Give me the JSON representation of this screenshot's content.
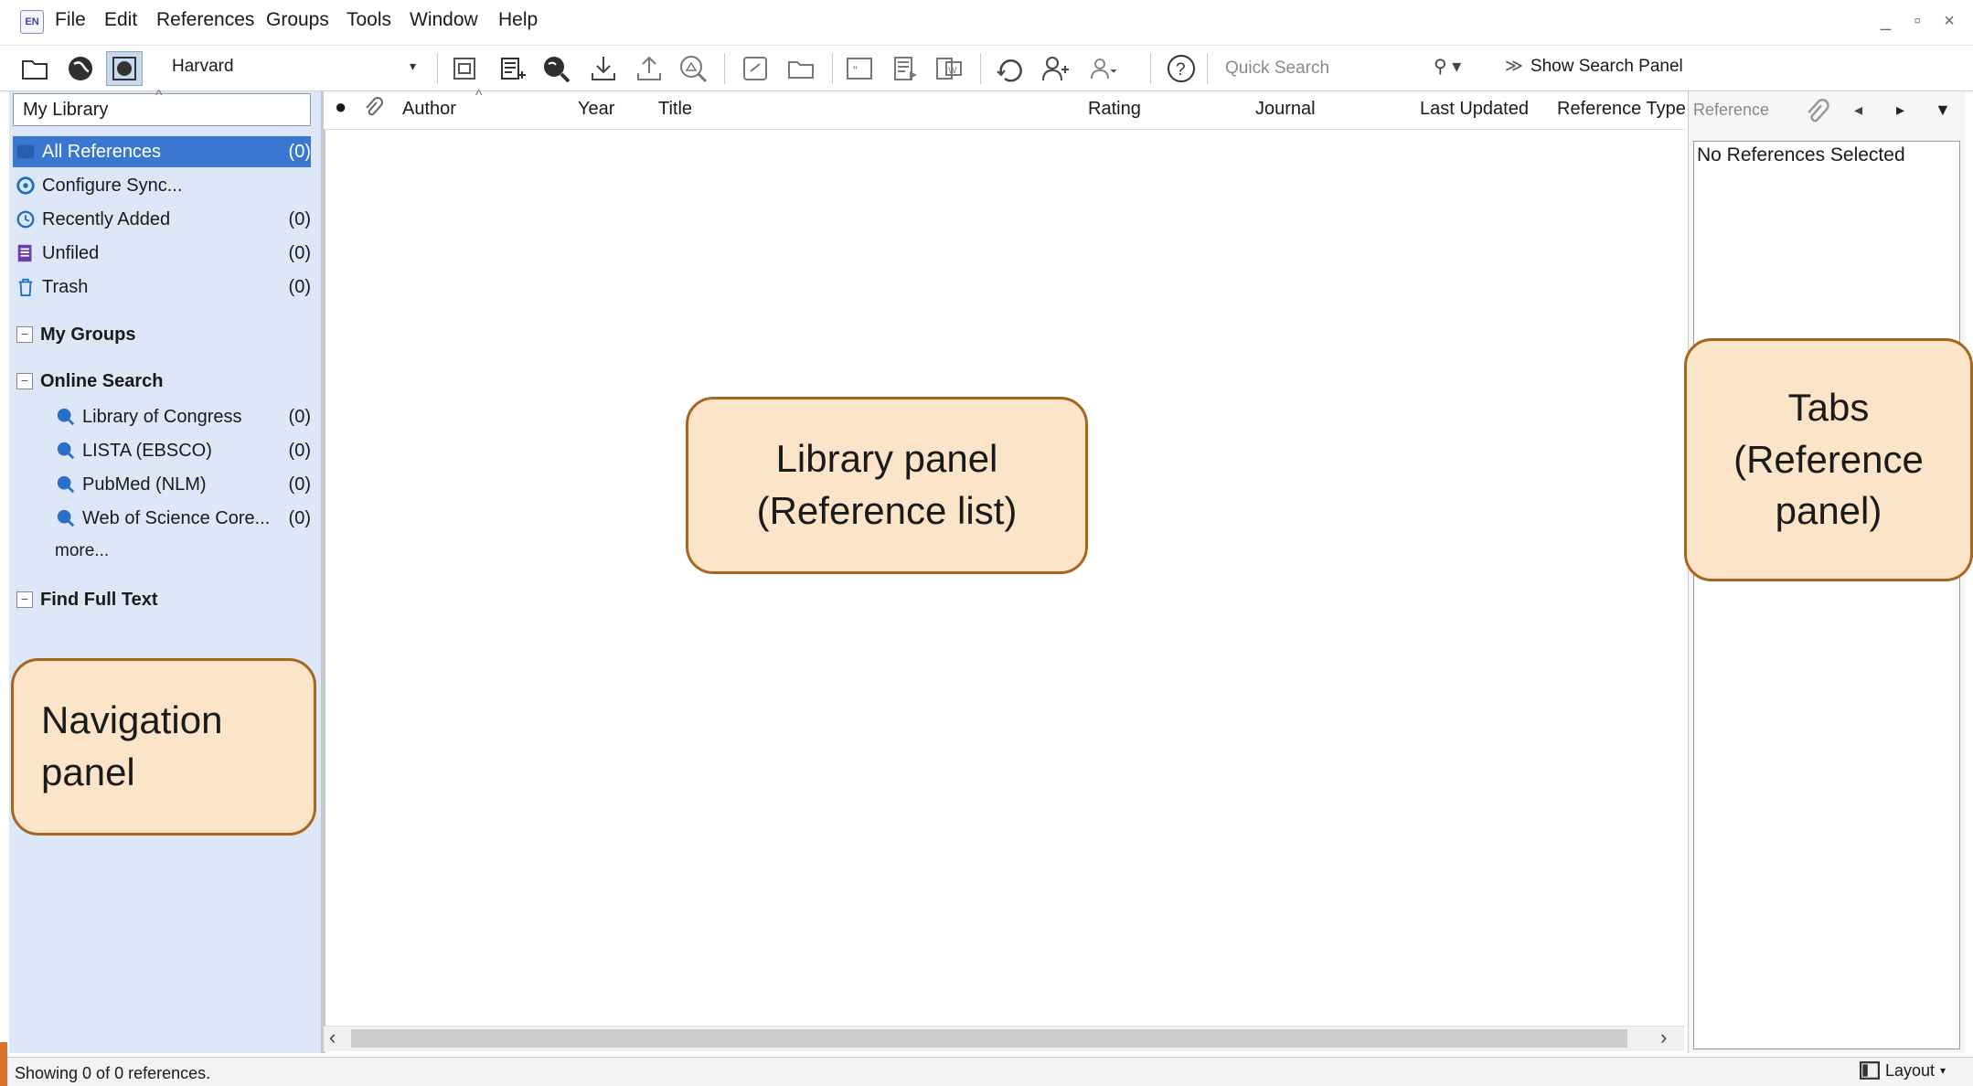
{
  "menubar": {
    "logo_text": "EN",
    "items": [
      "File",
      "Edit",
      "References",
      "Groups",
      "Tools",
      "Window",
      "Help"
    ],
    "window_controls": "_ ▫ ×"
  },
  "toolbar": {
    "citation_style": "Harvard",
    "quick_search_placeholder": "Quick Search",
    "show_search_panel": "Show Search Panel",
    "icons": [
      "local-library-icon",
      "online-search-icon",
      "integrated-library-icon",
      "new-group-icon",
      "new-reference-icon",
      "online-search-globe-icon",
      "import-icon",
      "export-icon",
      "find-full-text-icon",
      "open-link-icon",
      "open-file-icon",
      "insert-citation-icon",
      "format-bibliography-icon",
      "word-icon",
      "sync-icon",
      "share-icon",
      "manage-users-icon",
      "help-icon"
    ]
  },
  "nav": {
    "library_name": "My Library",
    "items": [
      {
        "label": "All References",
        "count": "(0)",
        "icon": "all-references-icon"
      },
      {
        "label": "Configure Sync...",
        "count": "",
        "icon": "sync-icon"
      },
      {
        "label": "Recently Added",
        "count": "(0)",
        "icon": "clock-icon"
      },
      {
        "label": "Unfiled",
        "count": "(0)",
        "icon": "unfiled-icon"
      },
      {
        "label": "Trash",
        "count": "(0)",
        "icon": "trash-icon"
      }
    ],
    "groups": {
      "my_groups": "My Groups",
      "online_search": "Online Search",
      "find_full_text": "Find Full Text"
    },
    "online_sources": [
      {
        "label": "Library of Congress",
        "count": "(0)"
      },
      {
        "label": "LISTA (EBSCO)",
        "count": "(0)"
      },
      {
        "label": "PubMed (NLM)",
        "count": "(0)"
      },
      {
        "label": "Web of Science Core...",
        "count": "(0)"
      }
    ],
    "more": "more..."
  },
  "library": {
    "columns": [
      "Author",
      "Year",
      "Title",
      "Rating",
      "Journal",
      "Last Updated",
      "Reference Type"
    ]
  },
  "reference_panel": {
    "tab": "Reference",
    "empty_message": "No References Selected"
  },
  "status": {
    "text": "Showing 0 of 0 references.",
    "layout": "Layout"
  },
  "callouts": {
    "library_line1": "Library panel",
    "library_line2": "(Reference list)",
    "tabs_line1": "Tabs",
    "tabs_line2": "(Reference",
    "tabs_line3": "panel)",
    "nav_line1": "Navigation",
    "nav_line2": "panel"
  },
  "colors": {
    "selection": "#3a77d0",
    "nav_background": "#dde7f7",
    "callout_fill": "#fbe4c8",
    "callout_border": "#a8651e"
  }
}
